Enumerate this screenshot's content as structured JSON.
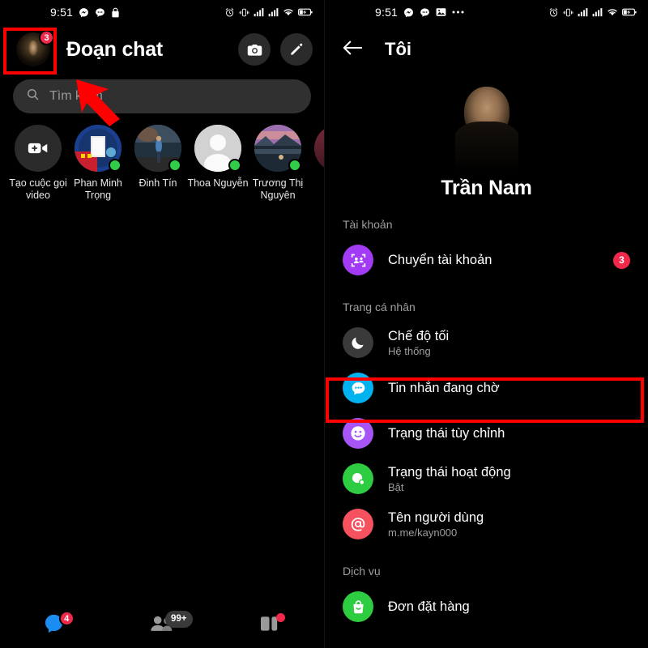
{
  "statusbar": {
    "time": "9:51",
    "left_icons": [
      "messenger-icon",
      "chat-bubble-icon",
      "lock-icon"
    ],
    "left_icons_right_panel": [
      "messenger-icon",
      "chat-bubble-icon",
      "image-icon",
      "more-dots-icon"
    ],
    "right_icons": [
      "alarm-icon",
      "vibrate-icon",
      "signal-icon",
      "signal-icon",
      "wifi-icon",
      "battery-charging-icon"
    ]
  },
  "left_panel": {
    "header": {
      "title": "Đoạn chat",
      "avatar_badge": "3",
      "camera_label": "camera-icon",
      "compose_label": "compose-icon"
    },
    "search": {
      "placeholder": "Tìm kiếm",
      "value": ""
    },
    "stories": [
      {
        "label": "Tạo cuộc gọi video",
        "type": "new-video-call",
        "online": false
      },
      {
        "label": "Phan Minh Trọng",
        "type": "avatar",
        "online": true
      },
      {
        "label": "Đinh Tín",
        "type": "avatar",
        "online": true
      },
      {
        "label": "Thoa Nguyễn",
        "type": "default-avatar",
        "online": true
      },
      {
        "label": "Trương Thị Nguyên",
        "type": "avatar",
        "online": true
      }
    ],
    "bottom_nav": [
      {
        "name": "chats",
        "icon": "chat-bubble-icon",
        "badge": "4",
        "badge_type": "count"
      },
      {
        "name": "people",
        "icon": "people-icon",
        "badge": "99+",
        "badge_type": "pill"
      },
      {
        "name": "stories",
        "icon": "stories-icon",
        "badge": "",
        "badge_type": "dot"
      }
    ]
  },
  "right_panel": {
    "header": {
      "back": "back-arrow-icon",
      "title": "Tôi"
    },
    "profile": {
      "name": "Trần Nam"
    },
    "sections": [
      {
        "label": "Tài khoản",
        "items": [
          {
            "title": "Chuyển tài khoản",
            "subtitle": "",
            "icon": "switch-account-icon",
            "color": "#a33bf5",
            "badge": "3"
          }
        ]
      },
      {
        "label": "Trang cá nhân",
        "items": [
          {
            "title": "Chế độ tối",
            "subtitle": "Hệ thống",
            "icon": "moon-icon",
            "color": "#3a3a3a",
            "badge": ""
          },
          {
            "title": "Tin nhắn đang chờ",
            "subtitle": "",
            "icon": "message-dots-icon",
            "color": "#00b2ef",
            "badge": ""
          },
          {
            "title": "Trạng thái tùy chỉnh",
            "subtitle": "",
            "icon": "smiley-icon",
            "color": "#a855f7",
            "badge": ""
          },
          {
            "title": "Trạng thái hoạt động",
            "subtitle": "Bật",
            "icon": "active-status-icon",
            "color": "#2ecc40",
            "badge": ""
          },
          {
            "title": "Tên người dùng",
            "subtitle": "m.me/kayn000",
            "icon": "at-sign-icon",
            "color": "#f5515f",
            "badge": ""
          }
        ]
      },
      {
        "label": "Dịch vụ",
        "items": [
          {
            "title": "Đơn đặt hàng",
            "subtitle": "",
            "icon": "shopping-bag-icon",
            "color": "#2ecc40",
            "badge": ""
          }
        ]
      }
    ]
  },
  "annotations": {
    "highlight_color": "#ff0000",
    "boxes": [
      "avatar-highlight",
      "pending-messages-highlight"
    ],
    "arrow": "red-arrow-pointing-to-avatar"
  }
}
